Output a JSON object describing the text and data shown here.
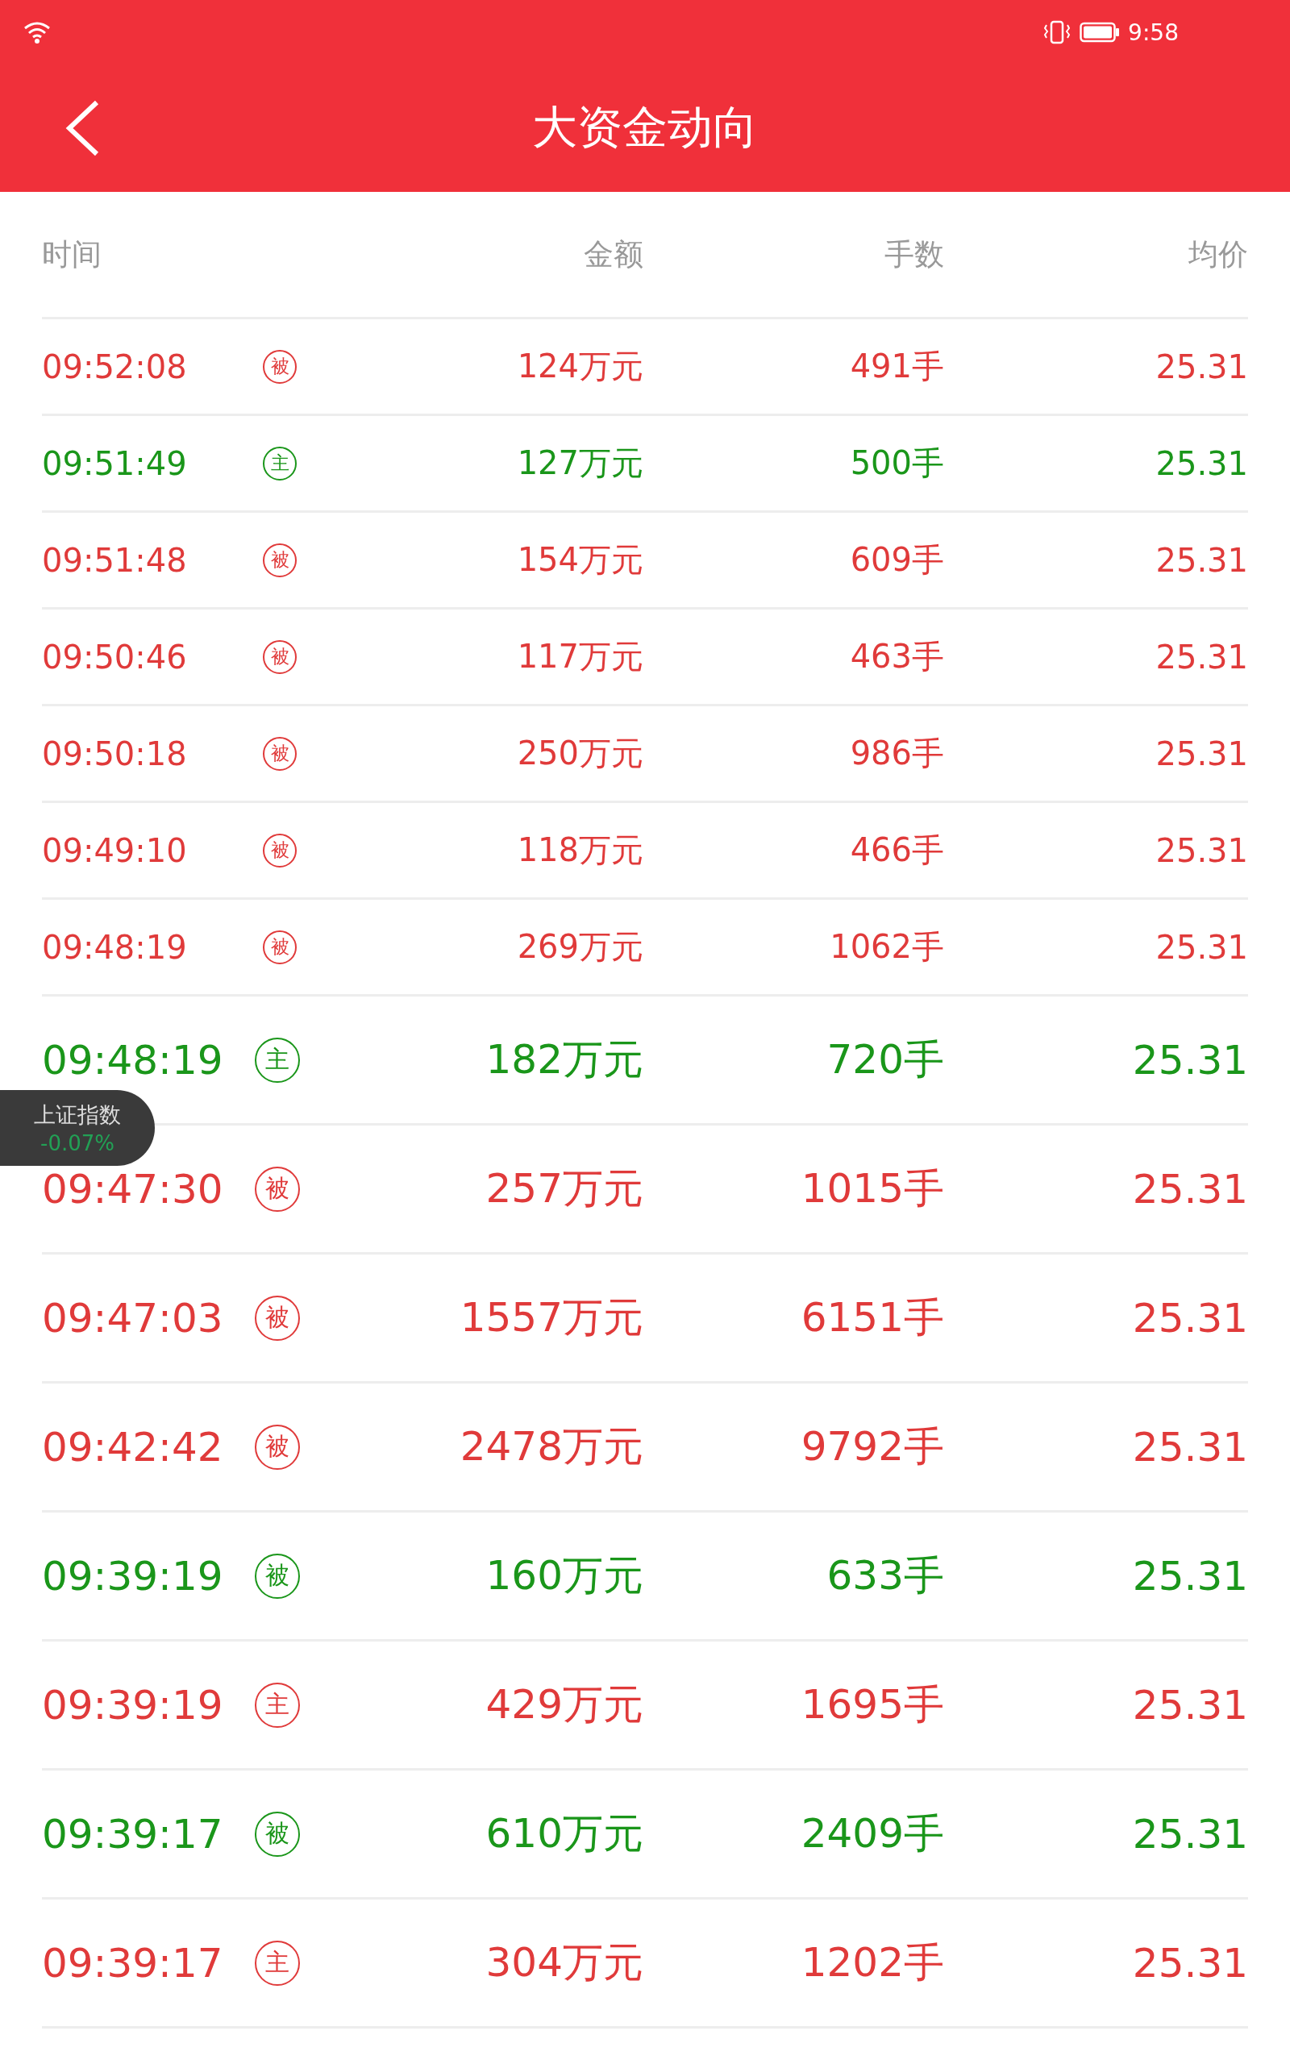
{
  "status_bar": {
    "time": "9:58"
  },
  "header": {
    "title": "大资金动向"
  },
  "table": {
    "columns": [
      "时间",
      "金额",
      "手数",
      "均价"
    ],
    "rows": [
      {
        "kind": "compact",
        "color": "#e03a3a",
        "time": "09:52:08",
        "tag": "被",
        "amount": "124万元",
        "volume": "491手",
        "price": "25.31"
      },
      {
        "kind": "compact",
        "color": "#1a961a",
        "time": "09:51:49",
        "tag": "主",
        "amount": "127万元",
        "volume": "500手",
        "price": "25.31"
      },
      {
        "kind": "compact",
        "color": "#e03a3a",
        "time": "09:51:48",
        "tag": "被",
        "amount": "154万元",
        "volume": "609手",
        "price": "25.31"
      },
      {
        "kind": "compact",
        "color": "#e03a3a",
        "time": "09:50:46",
        "tag": "被",
        "amount": "117万元",
        "volume": "463手",
        "price": "25.31"
      },
      {
        "kind": "compact",
        "color": "#e03a3a",
        "time": "09:50:18",
        "tag": "被",
        "amount": "250万元",
        "volume": "986手",
        "price": "25.31"
      },
      {
        "kind": "compact",
        "color": "#e03a3a",
        "time": "09:49:10",
        "tag": "被",
        "amount": "118万元",
        "volume": "466手",
        "price": "25.31"
      },
      {
        "kind": "compact",
        "color": "#e03a3a",
        "time": "09:48:19",
        "tag": "被",
        "amount": "269万元",
        "volume": "1062手",
        "price": "25.31"
      },
      {
        "kind": "large",
        "color": "#1a961a",
        "time": "09:48:19",
        "tag": "主",
        "amount": "182万元",
        "volume": "720手",
        "price": "25.31"
      },
      {
        "kind": "large",
        "color": "#e03a3a",
        "time": "09:47:30",
        "tag": "被",
        "amount": "257万元",
        "volume": "1015手",
        "price": "25.31"
      },
      {
        "kind": "large",
        "color": "#e03a3a",
        "time": "09:47:03",
        "tag": "被",
        "amount": "1557万元",
        "volume": "6151手",
        "price": "25.31"
      },
      {
        "kind": "large",
        "color": "#e03a3a",
        "time": "09:42:42",
        "tag": "被",
        "amount": "2478万元",
        "volume": "9792手",
        "price": "25.31"
      },
      {
        "kind": "large",
        "color": "#1a961a",
        "time": "09:39:19",
        "tag": "被",
        "amount": "160万元",
        "volume": "633手",
        "price": "25.31"
      },
      {
        "kind": "large",
        "color": "#e03a3a",
        "time": "09:39:19",
        "tag": "主",
        "amount": "429万元",
        "volume": "1695手",
        "price": "25.31"
      },
      {
        "kind": "large",
        "color": "#1a961a",
        "time": "09:39:17",
        "tag": "被",
        "amount": "610万元",
        "volume": "2409手",
        "price": "25.31"
      },
      {
        "kind": "large",
        "color": "#e03a3a",
        "time": "09:39:17",
        "tag": "主",
        "amount": "304万元",
        "volume": "1202手",
        "price": "25.31"
      }
    ]
  },
  "index_badge": {
    "name": "上证指数",
    "change": "-0.07%"
  }
}
